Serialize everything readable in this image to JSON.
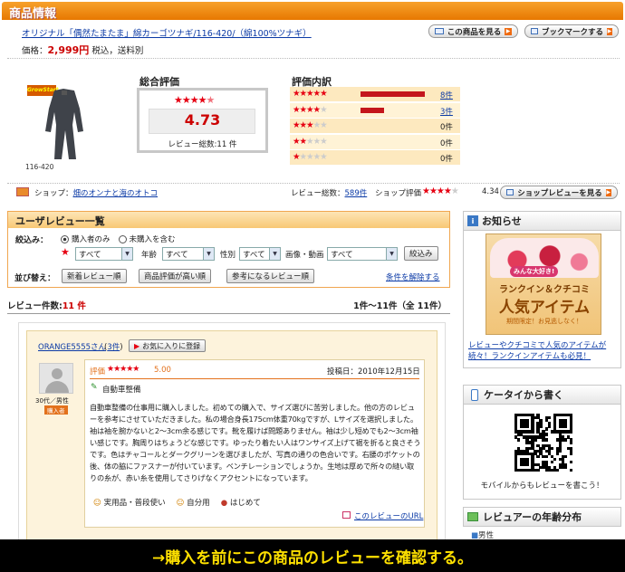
{
  "header": {
    "title": "商品情報"
  },
  "product": {
    "link": "オリジナル「偶然たまたま」綿カーゴツナギ/116-420/（綿100%ツナギ）",
    "price_label": "価格：",
    "price_value": "2,999円",
    "price_note": "税込，送料別",
    "image_caption": "116-420",
    "brand_badge": "GrowStart"
  },
  "top_buttons": {
    "view_product": "この商品を見る",
    "bookmark": "ブックマークする"
  },
  "rating": {
    "overall_title": "総合評価",
    "score": "4.73",
    "review_count_text": "レビュー総数:11 件",
    "overall_stars": 4.5
  },
  "breakdown": {
    "title": "評価内訳",
    "rows": [
      {
        "stars": 5,
        "count": "8件",
        "fraction": 0.73,
        "linked": true
      },
      {
        "stars": 4,
        "count": "3件",
        "fraction": 0.27,
        "linked": true
      },
      {
        "stars": 3,
        "count": "0件",
        "fraction": 0,
        "linked": false
      },
      {
        "stars": 2,
        "count": "0件",
        "fraction": 0,
        "linked": false
      },
      {
        "stars": 1,
        "count": "0件",
        "fraction": 0,
        "linked": false
      }
    ]
  },
  "shop_bar": {
    "shop_label": "ショップ：",
    "shop_name": "畑のオンナと海のオトコ",
    "total_label": "レビュー総数：",
    "total_value": "589件",
    "shop_rating_label": "ショップ評価",
    "shop_rating_value": "4.34",
    "shop_review_button": "ショップレビューを見る"
  },
  "user_review": {
    "title": "ユーザレビュー一覧",
    "filter_label": "絞込み：",
    "radio_purchasers": "購入者のみ",
    "radio_all": "未購入を含む",
    "selects": [
      {
        "label": "",
        "value": "すべて"
      },
      {
        "label": "年齢",
        "value": "すべて"
      },
      {
        "label": "性別",
        "value": "すべて"
      },
      {
        "label": "画像・動画",
        "value": "すべて"
      }
    ],
    "filter_button": "絞込み",
    "sort_label": "並び替え：",
    "sort_buttons": [
      "新着レビュー順",
      "商品評価が高い順",
      "参考になるレビュー順"
    ],
    "clear_filter": "条件を解除する",
    "count_label": "レビュー件数:",
    "count_value": "11 件",
    "range": "1件〜11件（全 11件）"
  },
  "review": {
    "reviewer_name": "ORANGE5555さん",
    "reviewer_count": "3件",
    "favorite_button": "お気に入りに登録",
    "rating_label": "評価",
    "rating_value": "5.00",
    "post_date": "投稿日：2010年12月15日",
    "tag": "自動車整備",
    "age": "30代／男性",
    "buyer_badge": "購入者",
    "body": "自動車整備の仕事用に購入しました。初めての購入で、サイズ選びに苦労しました。他の方のレビューを参考にさせていただきました。私の場合身長175cm体重70kgですが、Lサイズを選択しました。袖は袖を腕かないと2〜3cm余る感じです。靴を履けば問題ありません。袖は少し短めでも2〜3cm袖い感じです。胸周りはちょうどな感じです。ゆったり着たい人はワンサイズ上げて裾を折ると良さそうです。色はチャコールとダークグリーンを選びましたが、写真の通りの色合いです。右腰のポケットの後、体の脇にファスナーが付いています。ベンチレーションでしょうか。生地は厚めで所々の縫い取りの糸が、赤い糸を使用してさりげなくアクセントになっています。",
    "tags": [
      "実用品・普段使い",
      "自分用",
      "はじめて"
    ],
    "permalink": "このレビューのURL"
  },
  "sidebar": {
    "notice_title": "お知らせ",
    "banner_badge": "みんな大好き!",
    "banner_line1": "ランクイン＆クチコミ",
    "banner_line2": "人気アイテム",
    "banner_sub": "期間限定！お見逃しなく！",
    "notice_link": "レビューやクチコミで人気のアイテムが続々！ランクインアイテムも必見！",
    "mobile_title": "ケータイから書く",
    "mobile_caption": "モバイルからもレビューを書こう！",
    "age_title": "レビュアーの年齢分布",
    "age_first_row": "男性"
  },
  "bottom_banner": {
    "text": "→購入を前にこの商品のレビューを確認する。"
  },
  "colors": {
    "brand_orange": "#f08c00",
    "price_red": "#cc0000",
    "star_red": "#e60012",
    "link_blue": "#0b3aa6"
  }
}
